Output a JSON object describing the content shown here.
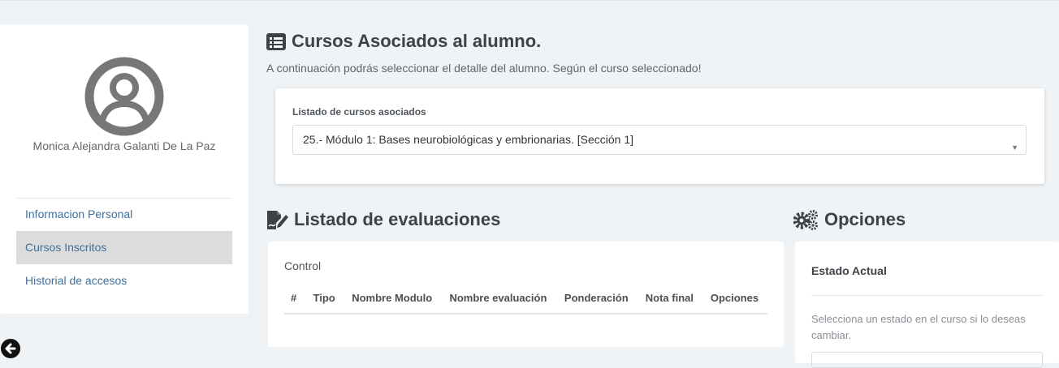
{
  "profile": {
    "name": "Monica Alejandra Galanti De La Paz",
    "menu": [
      {
        "label": "Informacion Personal",
        "active": false
      },
      {
        "label": "Cursos Inscritos",
        "active": true
      },
      {
        "label": "Historial de accesos",
        "active": false
      }
    ]
  },
  "courses": {
    "title": "Cursos Asociados al alumno.",
    "subtitle": "A continuación podrás seleccionar el detalle del alumno. Según el curso seleccionado!",
    "select_label": "Listado de cursos asociados",
    "selected_course": "25.- Módulo 1: Bases neurobiológicas y embrionarias. [Sección 1]"
  },
  "evaluations": {
    "title": "Listado de evaluaciones",
    "control_label": "Control",
    "columns": [
      "#",
      "Tipo",
      "Nombre Modulo",
      "Nombre evaluación",
      "Ponderación",
      "Nota final",
      "Opciones"
    ]
  },
  "options": {
    "title": "Opciones",
    "state_label": "Estado Actual",
    "help_text": "Selecciona un estado en el curso si lo deseas cambiar."
  },
  "icons": {
    "avatar": "user-circle-icon",
    "back": "arrow-circle-left-icon",
    "list": "list-alt-icon",
    "edit": "file-signature-icon",
    "gears": "cogs-icon"
  },
  "colors": {
    "link": "#3f6f99",
    "active_item": "#dcdcdc",
    "background": "#f0f3f6"
  }
}
